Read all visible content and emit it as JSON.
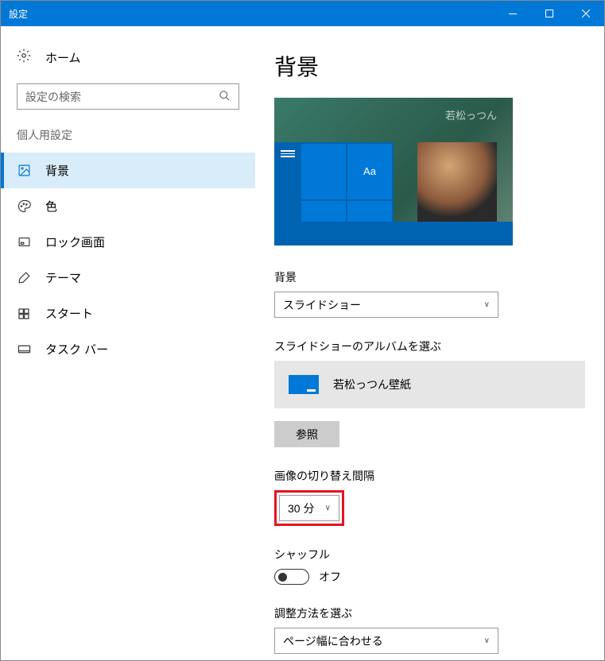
{
  "window": {
    "title": "設定"
  },
  "sidebar": {
    "home": "ホーム",
    "search_placeholder": "設定の検索",
    "section": "個人用設定",
    "items": [
      {
        "label": "背景",
        "active": true
      },
      {
        "label": "色"
      },
      {
        "label": "ロック画面"
      },
      {
        "label": "テーマ"
      },
      {
        "label": "スタート"
      },
      {
        "label": "タスク バー"
      }
    ]
  },
  "main": {
    "title": "背景",
    "preview_tile_text": "Aa",
    "preview_corner": "若松っつん",
    "bg_label": "背景",
    "bg_value": "スライドショー",
    "album_label": "スライドショーのアルバムを選ぶ",
    "album_name": "若松っつん壁紙",
    "browse_label": "参照",
    "interval_label": "画像の切り替え間隔",
    "interval_value": "30 分",
    "shuffle_label": "シャッフル",
    "shuffle_state": "オフ",
    "fit_label": "調整方法を選ぶ",
    "fit_value": "ページ幅に合わせる"
  }
}
